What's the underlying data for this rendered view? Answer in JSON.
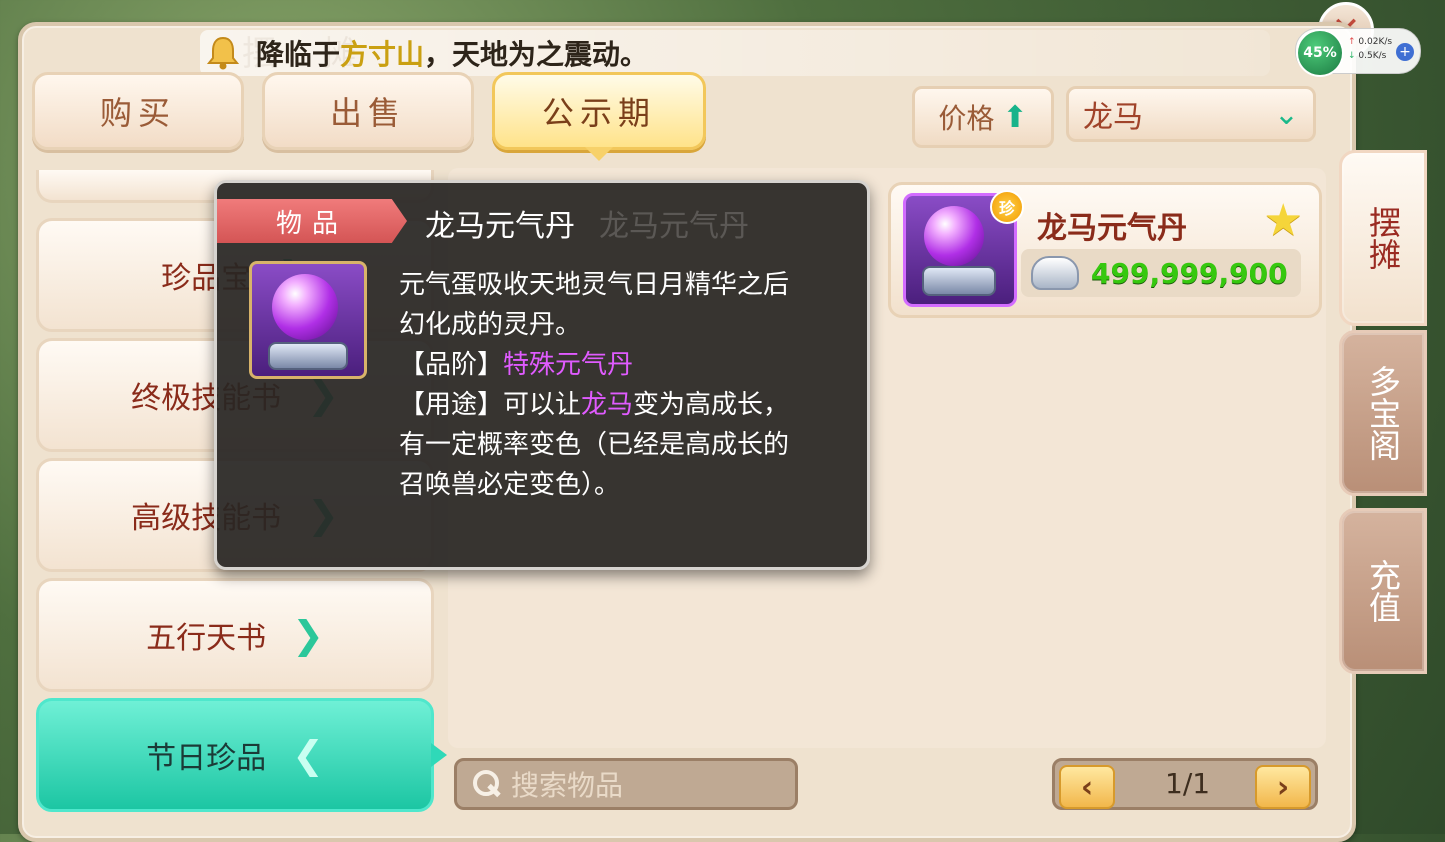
{
  "header": {
    "bg_title": "摆 摊",
    "notice": {
      "prefix": "降临于",
      "highlight": "方寸山",
      "suffix": "，天地为之震动。"
    }
  },
  "system_status": {
    "battery_pct": "45%",
    "upload": "0.02K/s",
    "download": "0.5K/s"
  },
  "top_tabs": [
    {
      "label": "购买",
      "active": false
    },
    {
      "label": "出售",
      "active": false
    },
    {
      "label": "公示期",
      "active": true
    }
  ],
  "sort": {
    "label": "价格",
    "direction": "up"
  },
  "filter": {
    "selected": "龙马"
  },
  "categories": [
    {
      "label": "珍品宝"
    },
    {
      "label": "终极技能书"
    },
    {
      "label": "高级技能书"
    },
    {
      "label": "五行天书"
    },
    {
      "label": "节日珍品",
      "active": true
    }
  ],
  "listing": {
    "name": "龙马元气丹",
    "badge": "珍",
    "price": "499,999,900",
    "favorited": true
  },
  "tooltip": {
    "tag": "物品",
    "title": "龙马元气丹",
    "ghost_title": "龙马元气丹",
    "desc_line1": "元气蛋吸收天地灵气日月精华之后",
    "desc_line2": "幻化成的灵丹。",
    "grade_label": "【品阶】",
    "grade_value": "特殊元气丹",
    "use_label": "【用途】",
    "use_pre": "可以让",
    "use_highlight": "龙马",
    "use_post": "变为高成长，",
    "use_line2": "有一定概率变色（已经是高成长的",
    "use_line3": "召唤兽必定变色）。"
  },
  "search": {
    "placeholder": "搜索物品"
  },
  "pagination": {
    "text": "1/1"
  },
  "side_tabs": [
    {
      "label": "摆摊",
      "active": true
    },
    {
      "label": "多宝阁",
      "active": false
    },
    {
      "label": "充值",
      "active": false
    }
  ],
  "icons": {
    "bell": "bell-icon",
    "sort_arrow": "arrow-up-icon",
    "dropdown": "chevron-down-icon",
    "category_chevron": "chevron-right-icon",
    "active_chevron": "chevron-left-icon",
    "favorite": "star-icon",
    "currency": "silver-ingot-icon",
    "search": "magnifier-icon",
    "close": "close-icon"
  },
  "colors": {
    "accent": "#1cc6a3",
    "price": "#36c80f",
    "highlight": "#e05bff",
    "notice_highlight": "#caa012"
  }
}
